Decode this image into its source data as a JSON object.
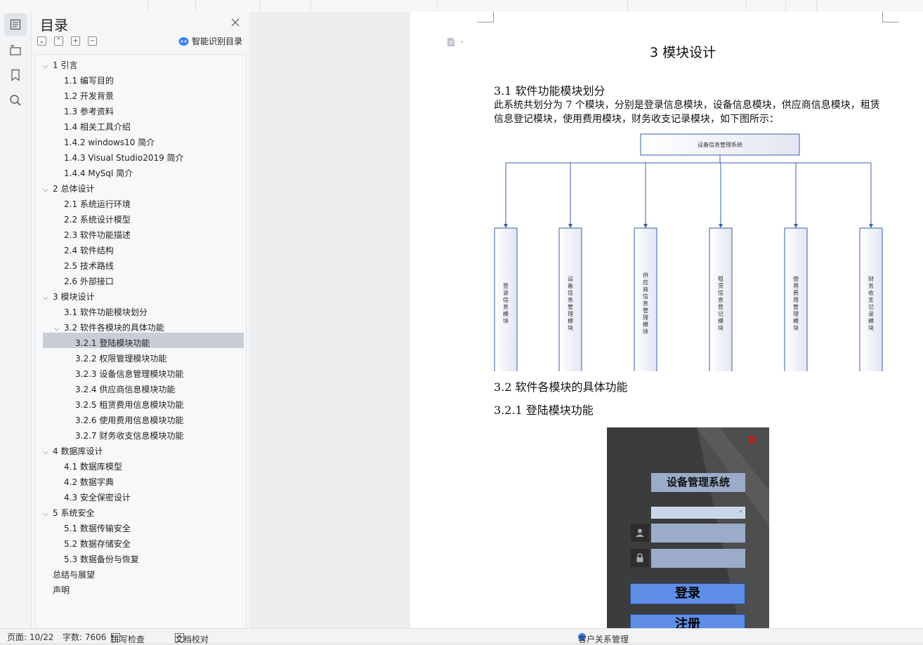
{
  "toc_panel": {
    "title": "目录",
    "smart_label": "智能识别目录",
    "items": [
      {
        "label": "1  引言",
        "level": 1,
        "expanded": true
      },
      {
        "label": "1.1  编写目的",
        "level": 2
      },
      {
        "label": "1.2  开发背景",
        "level": 2
      },
      {
        "label": "1.3  参考资料",
        "level": 2
      },
      {
        "label": "1.4  相关工具介绍",
        "level": 2
      },
      {
        "label": "1.4.2 windows10 简介",
        "level": 2
      },
      {
        "label": "1.4.3 Visual Studio2019 简介",
        "level": 2
      },
      {
        "label": "1.4.4 MySql 简介",
        "level": 2
      },
      {
        "label": "2  总体设计",
        "level": 1,
        "expanded": true
      },
      {
        "label": "2.1  系统运行环境",
        "level": 2
      },
      {
        "label": "2.2  系统设计模型",
        "level": 2
      },
      {
        "label": "2.3  软件功能描述",
        "level": 2
      },
      {
        "label": "2.4  软件结构",
        "level": 2
      },
      {
        "label": "2.5  技术路线",
        "level": 2
      },
      {
        "label": "2.6  外部接口",
        "level": 2
      },
      {
        "label": "3  模块设计",
        "level": 1,
        "expanded": true,
        "selected": true
      },
      {
        "label": "3.1  软件功能模块划分",
        "level": 2
      },
      {
        "label": "3.2  软件各模块的具体功能",
        "level": 2,
        "expanded": true
      },
      {
        "label": "3.2.1 登陆模块功能",
        "level": 3
      },
      {
        "label": "3.2.2 权限管理模块功能",
        "level": 3
      },
      {
        "label": "3.2.3 设备信息管理模块功能",
        "level": 3
      },
      {
        "label": "3.2.4 供应商信息模块功能",
        "level": 3
      },
      {
        "label": "3.2.5 租赁费用信息模块功能",
        "level": 3
      },
      {
        "label": "3.2.6 使用费用信息模块功能",
        "level": 3
      },
      {
        "label": "3.2.7 财务收支信息模块功能",
        "level": 3
      },
      {
        "label": "4  数据库设计",
        "level": 1,
        "expanded": true
      },
      {
        "label": "4.1  数据库模型",
        "level": 2
      },
      {
        "label": "4.2  数据字典",
        "level": 2
      },
      {
        "label": "4.3  安全保密设计",
        "level": 2
      },
      {
        "label": "5  系统安全",
        "level": 1,
        "expanded": true
      },
      {
        "label": "5.1  数据传输安全",
        "level": 2
      },
      {
        "label": "5.2  数据存储安全",
        "level": 2
      },
      {
        "label": "5.3  数据备份与恢复",
        "level": 2
      },
      {
        "label": "总结与展望",
        "level": 0
      },
      {
        "label": "声明",
        "level": 0
      }
    ]
  },
  "document": {
    "heading": "3  模块设计",
    "section_31": "3.1  软件功能模块划分",
    "paragraph": "此系统共划分为 7 个模块，分别是登录信息模块，设备信息模块，供应商信息模块，租赁信息登记模块，使用费用模块，财务收支记录模块，如下图所示：",
    "diagram": {
      "root": "设备信息管理系统",
      "modules": [
        "登录信息模块",
        "设备信息管理模块",
        "供应商信息管理模块",
        "租赁信息登记模块",
        "使用费用管理模块",
        "财务收支记录模块"
      ]
    },
    "section_32": "3.2  软件各模块的具体功能",
    "section_321": "3.2.1 登陆模块功能",
    "login_image": {
      "title": "设备管理系统",
      "login_button": "登录",
      "register_button": "注册"
    }
  },
  "status_bar": {
    "page": "页面: 10/22",
    "words": "字数: 7606",
    "spell_check": "拼写检查",
    "proofread": "文档校对",
    "center": "客户关系管理"
  },
  "colors": {
    "selected_row": "#c9ced6",
    "diagram_stroke": "#3a5fa8",
    "login_accent": "#5f8ee6"
  }
}
